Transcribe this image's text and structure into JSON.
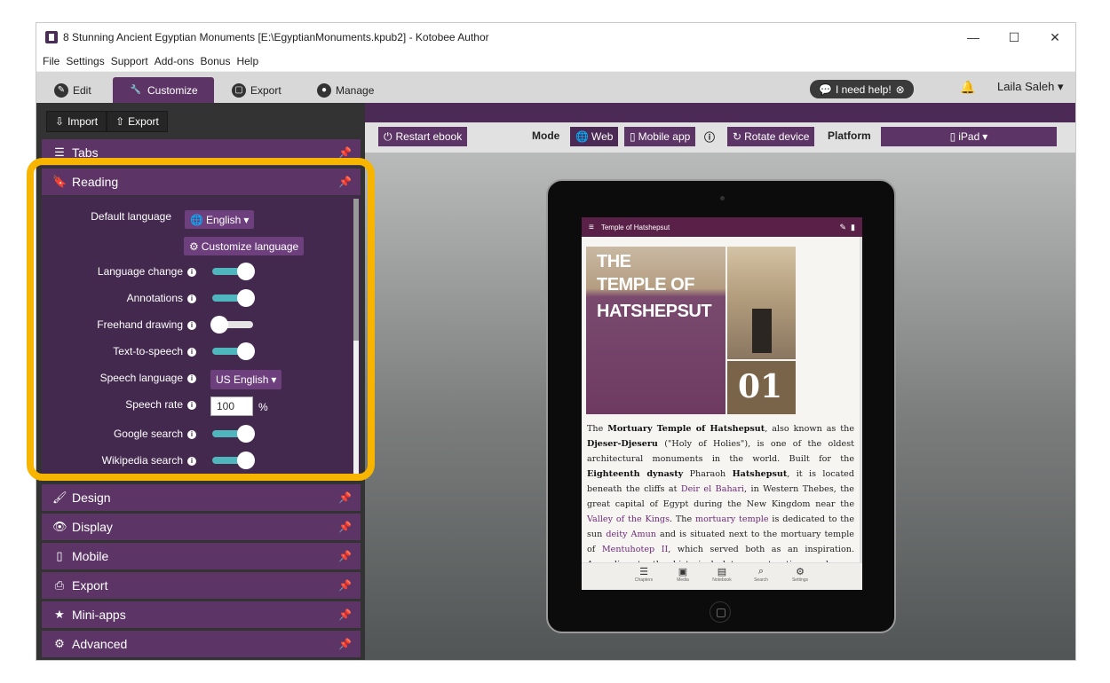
{
  "window": {
    "title": "8 Stunning Ancient Egyptian Monuments [E:\\EgyptianMonuments.kpub2] - Kotobee Author",
    "controls": {
      "minimize": "—",
      "maximize": "☐",
      "close": "✕"
    }
  },
  "menu": [
    "File",
    "Settings",
    "Support",
    "Add-ons",
    "Bonus",
    "Help"
  ],
  "main_tabs": [
    {
      "label": "Edit",
      "icon": "pencil-icon"
    },
    {
      "label": "Customize",
      "icon": "wrench-icon",
      "active": true
    },
    {
      "label": "Export",
      "icon": "export-icon"
    },
    {
      "label": "Manage",
      "icon": "user-icon"
    }
  ],
  "help_button": "I need help!",
  "user_name": "Laila Saleh",
  "import_export": {
    "import": "Import",
    "export": "Export"
  },
  "panels": {
    "tabs": "Tabs",
    "reading": "Reading",
    "design": "Design",
    "display": "Display",
    "mobile": "Mobile",
    "export": "Export",
    "miniapps": "Mini-apps",
    "advanced": "Advanced"
  },
  "reading": {
    "default_language_label": "Default language",
    "default_language_value": "English",
    "customize_language": "Customize language",
    "language_change": {
      "label": "Language change",
      "on": true
    },
    "annotations": {
      "label": "Annotations",
      "on": true
    },
    "freehand_drawing": {
      "label": "Freehand drawing",
      "on": false
    },
    "text_to_speech": {
      "label": "Text-to-speech",
      "on": true
    },
    "speech_language_label": "Speech language",
    "speech_language_value": "US English",
    "speech_rate_label": "Speech rate",
    "speech_rate_value": "100",
    "speech_rate_unit": "%",
    "google_search": {
      "label": "Google search",
      "on": true
    },
    "wikipedia_search": {
      "label": "Wikipedia search",
      "on": true
    }
  },
  "preview_toolbar": {
    "restart": "Restart ebook",
    "mode_label": "Mode",
    "mode_web": "Web",
    "mode_mobile": "Mobile app",
    "rotate": "Rotate device",
    "platform_label": "Platform",
    "platform_value": "iPad"
  },
  "ebook": {
    "header_title": "Temple of Hatshepsut",
    "hero_line1": "THE",
    "hero_line2": "TEMPLE OF",
    "hero_line3": "HATSHEPSUT",
    "chapter_number": "01",
    "footer": [
      "Chapters",
      "Media",
      "Notebook",
      "Search",
      "Settings"
    ]
  },
  "colors": {
    "accent": "#5c3566",
    "toggle_on": "#4fb6bd",
    "highlight": "#f7b500"
  }
}
